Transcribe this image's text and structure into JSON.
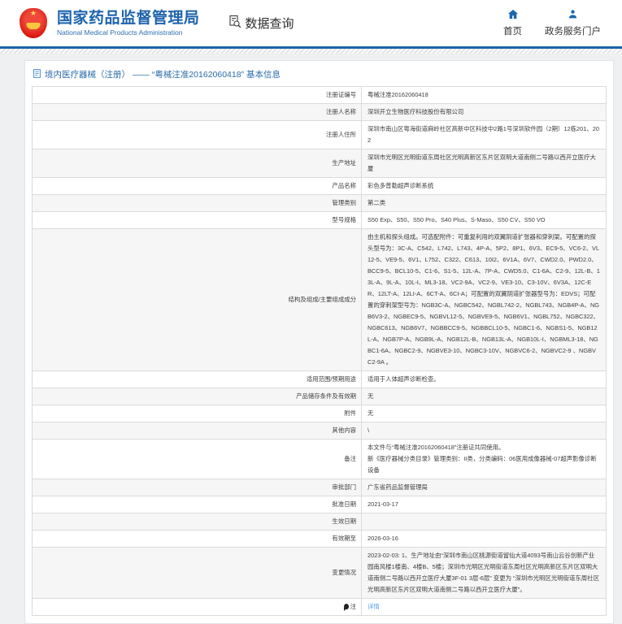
{
  "header": {
    "agency_name": "国家药品监督管理局",
    "agency_name_en": "National Medical Products Administration",
    "data_query_label": "数据查询",
    "nav_home": "首页",
    "nav_portal": "政务服务门户"
  },
  "page_title": "境内医疗器械（注册） —— “粤械注准20162060418” 基本信息",
  "table": {
    "rows": [
      {
        "label": "注册证编号",
        "value": "粤械注准20162060418"
      },
      {
        "label": "注册人名称",
        "value": "深圳开立生物医疗科技股份有限公司"
      },
      {
        "label": "注册人住所",
        "value": "深圳市南山区粤海街道麻岭社区高新中区科技中2路1号深圳软件园（2期）12栋201、202"
      },
      {
        "label": "生产地址",
        "value": "深圳市光明区光明街道东周社区光明高新区东片区双明大道南侧二号路以西开立医疗大厦"
      },
      {
        "label": "产品名称",
        "value": "彩色多普勒超声诊断系统"
      },
      {
        "label": "管理类别",
        "value": "第二类"
      },
      {
        "label": "型号规格",
        "value": "S50 Exp、S50、S50 Pro、S40 Plus、S-Maso、S50 CV、S50 VO"
      },
      {
        "label": "结构及组成/主要组成成分",
        "value": "由主机和探头组成。可选配附件：可重复利用的双翼阴道扩张器和穿刺架。可配置的探头型号为：3C-A、C542、L742、L743、4P-A、5P2、8P1、6V3、EC9-5、VC6-2、VL12-5、VE9-5、6V1、L752、C322、C613、10I2、6V1A、6V7、CWD2.0、PWD2.0、BCC9-5、BCL10-5、C1-6、S1-5、12L-A、7P-A、CWD5.0、C1-6A、C2-9、12L-B、13L-A、9L-A、10L-I、ML3-18、VC2-9A、VC2-9、VE3-10、C3-10V、6V3A、12C-ER、12LT-A、12LI-A、6CT-A、6CI-A；可配置的双翼阴道扩张器型号为：EDVS；可配置的穿刺架型号为：NGB3C-A、NGBC542、NGBL742-2、NGBL743、NGB4P-A、NGB6V3-2、NGBEC9-5、NGBVL12-5、NGBVE9-5、NGB6V1、NGBL752、NGBC322、NGBC613、NGB6V7、NGBBCC9-5、NGBBCL10-5、NGBC1-6、NGBS1-5、NGB12L-A、NGB7P-A、NGB9L-A、NGB12L-B、NGB13L-A、NGB10L-I、NGBML3-18、NGBC1-6A、NGBC2-9、NGBVE3-10、NGBC3-10V、NGBVC6-2、NGBVC2-9 、NGBVC2-9A 。"
      },
      {
        "label": "适用范围/预期用途",
        "value": "适用于人体超声诊断检查。"
      },
      {
        "label": "产品储存条件及有效期",
        "value": "无"
      },
      {
        "label": "附件",
        "value": "无"
      },
      {
        "label": "其他内容",
        "value": "\\"
      },
      {
        "label": "备注",
        "lines": [
          "本文件与“粤械注准20162060418”注册证共同使用。",
          "新《医疗器械分类目录》管理类别：II类，分类编码：06医用成像器械-07超声影像诊断设备"
        ]
      },
      {
        "label": "审批部门",
        "value": "广东省药品监督管理局"
      },
      {
        "label": "批准日期",
        "value": "2021-03-17"
      },
      {
        "label": "生效日期",
        "value": ""
      },
      {
        "label": "有效期至",
        "value": "2026-03-16"
      },
      {
        "label": "变更情况",
        "value": "2023-02-03: 1、生产地址由“深圳市南山区桃源街道留仙大道4093号南山云谷创新产业园南风楼1楼南、4楼B、5楼；深圳市光明区光明街道东周社区光明高新区东片区双明大道南侧二号路以西开立医疗大厦3F-01 3层-6层” 变更为 “深圳市光明区光明街道东周社区光明高新区东片区双明大道南侧二号路以西开立医疗大厦”。"
      },
      {
        "label": "注",
        "icon": "note-icon",
        "link": {
          "text": "详情"
        }
      }
    ]
  },
  "colors": {
    "brand_blue": "#1b62ab",
    "title_blue": "#2a6ba8",
    "link_blue": "#4d9fe8",
    "emblem_red": "#d7150b"
  }
}
